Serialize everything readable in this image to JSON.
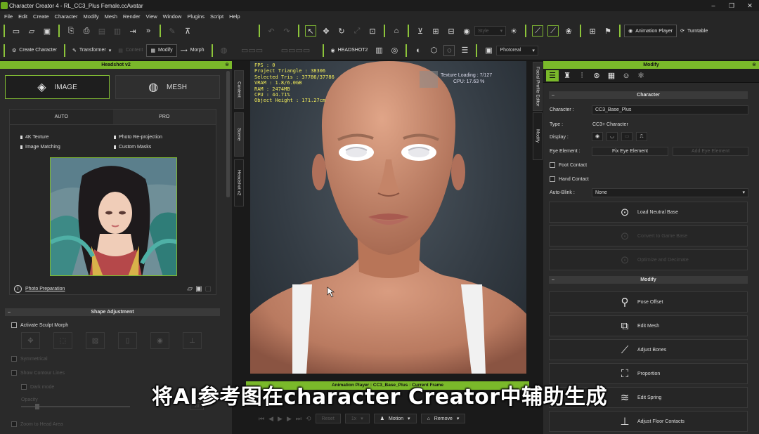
{
  "window": {
    "title": "Character Creator 4 - RL_CC3_Plus Female.ccAvatar",
    "controls": [
      "–",
      "❐",
      "✕"
    ]
  },
  "menu": [
    "File",
    "Edit",
    "Create",
    "Character",
    "Modify",
    "Mesh",
    "Render",
    "View",
    "Window",
    "Plugins",
    "Script",
    "Help"
  ],
  "toolbar1": {
    "style_select": "Style",
    "animation_player": "Animation Player",
    "turntable": "Turntable"
  },
  "toolbar2": {
    "create_character": "Create Character",
    "transformer": "Transformer",
    "content": "Content",
    "modify": "Modify",
    "morph": "Morph",
    "headshot2": "HEADSHOT2",
    "render_mode": "Photoreal"
  },
  "left_panel": {
    "title": "Headshot v2",
    "modes": {
      "image": "IMAGE",
      "mesh": "MESH"
    },
    "tabs": [
      "AUTO",
      "PRO"
    ],
    "features": [
      "4K Texture",
      "Image Matching",
      "Photo Re-projection",
      "Custom Masks"
    ],
    "photo_preparation": "Photo Preparation",
    "shape_adjustment": {
      "title": "Shape Adjustment",
      "activate_sculpt_morph": "Activate Sculpt Morph",
      "symmetrical": "Symmetrical",
      "show_contour": "Show Contour Lines",
      "dark_mode": "Dark mode",
      "opacity": "Opacity",
      "opacity_value": "20",
      "zoom_to_head": "Zoom to Head Area"
    }
  },
  "side_tabs": {
    "left": [
      "Content",
      "Scene",
      "Headshot v2"
    ],
    "right": [
      "Facial Profile Editor",
      "Modify"
    ]
  },
  "viewport": {
    "stats": [
      "FPS : 0",
      "Project Triangle : 38306",
      "Selected Tris : 37786/37786",
      "VRAM : 1.8/6.0GB",
      "RAM : 2474MB",
      "CPU : 44.71%",
      "Object Height : 171.27cm"
    ],
    "texture_loading": "Texture Loading : 7/127",
    "cpu": "CPU: 17.63 %"
  },
  "animation": {
    "title": "Animation Player : CC3_Base_Plus : Current Frame",
    "reset": "Reset",
    "speed": "1x",
    "motion": "Motion",
    "remove": "Remove"
  },
  "right_panel": {
    "title": "Modify",
    "character_section": "Character",
    "character_label": "Character :",
    "character_value": "CC3_Base_Plus",
    "type_label": "Type :",
    "type_value": "CC3+ Character",
    "display_label": "Display :",
    "eye_element_label": "Eye Element :",
    "fix_eye_element": "Fix Eye Element",
    "add_eye_element": "Add Eye Element",
    "foot_contact": "Foot Contact",
    "hand_contact": "Hand Contact",
    "auto_blink_label": "Auto-Blink :",
    "auto_blink_value": "None",
    "load_neutral_base": "Load Neutral Base",
    "convert_to_game_base": "Convert to Game Base",
    "optimize_and_decimate": "Optimize and Decimate",
    "modify_section": "Modify",
    "pose_offset": "Pose Offset",
    "edit_mesh": "Edit Mesh",
    "adjust_bones": "Adjust Bones",
    "proportion": "Proportion",
    "edit_spring": "Edit Spring",
    "adjust_floor_contacts": "Adjust Floor Contacts"
  },
  "caption": "将AI参考图在character Creator中辅助生成",
  "colors": {
    "accent": "#7ab92a",
    "stats": "#f2ec5a",
    "panel": "#2a2a2a"
  }
}
